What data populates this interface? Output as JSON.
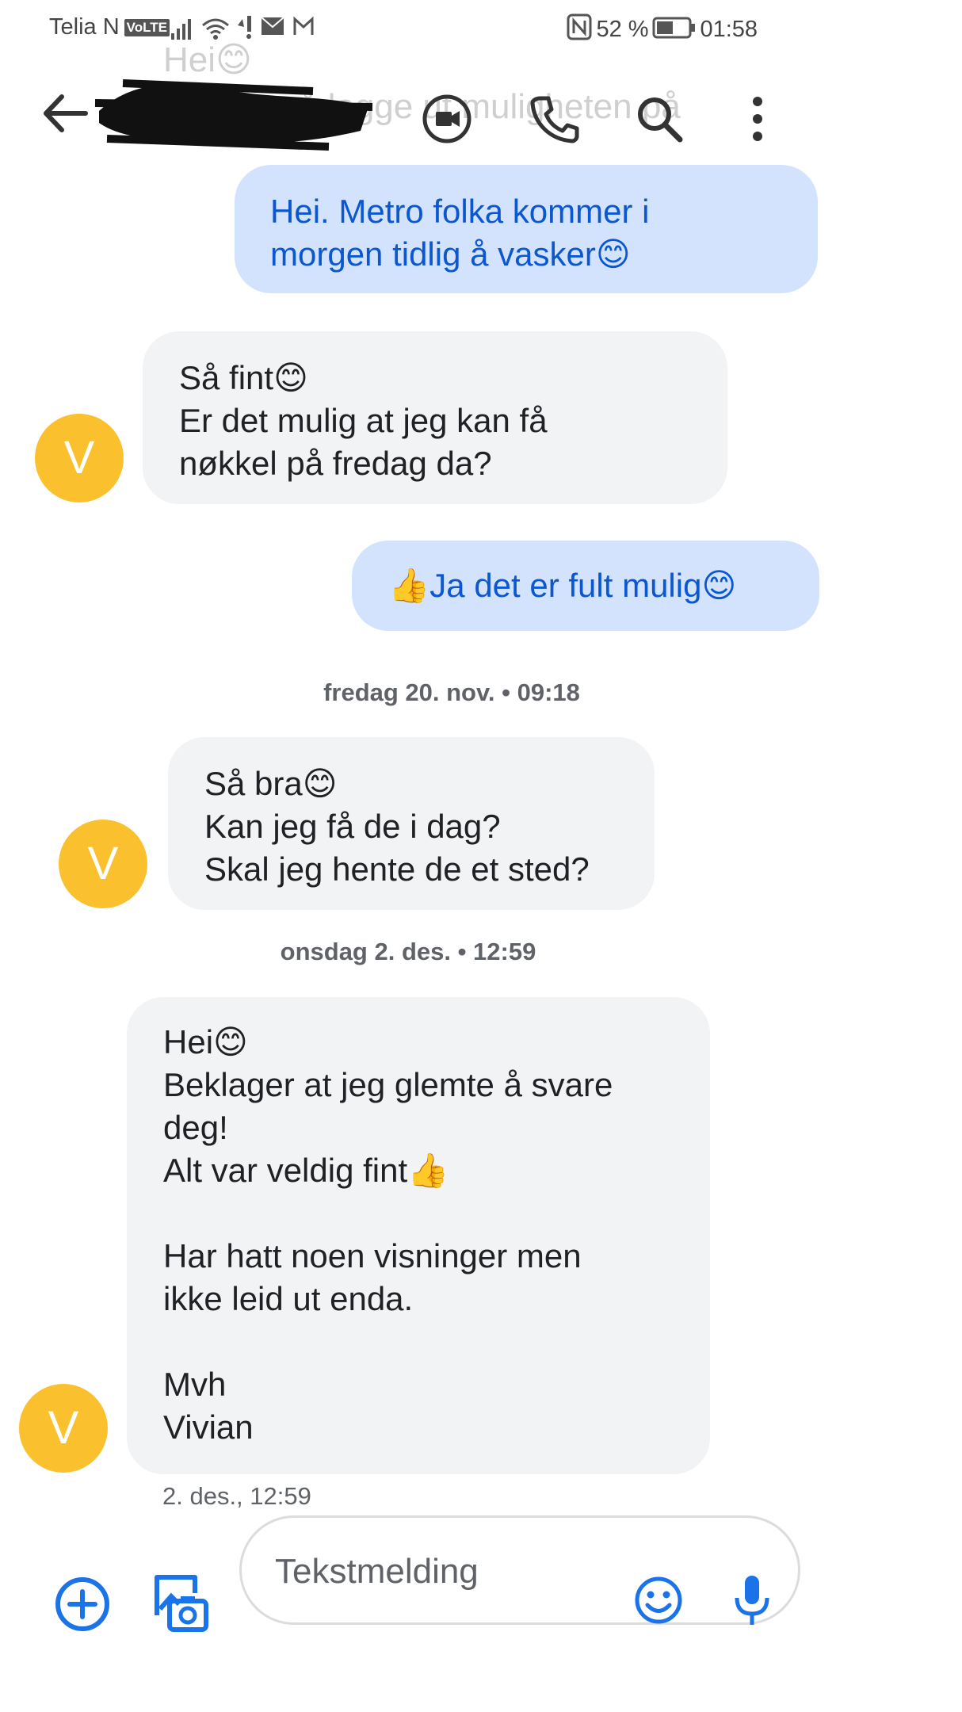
{
  "status": {
    "carrier": "Telia N",
    "network_badge": "VoLTE",
    "battery": "52 %",
    "time": "01:58"
  },
  "header": {
    "preview_line1": "Hei😊",
    "preview_line2": "r å legge ut muligheten på"
  },
  "avatar_letter": "V",
  "messages": [
    {
      "dir": "out",
      "text": "Hei. Metro folka kommer i\nmorgen tidlig å vasker😊"
    },
    {
      "dir": "in",
      "text": "Så fint😊\nEr det mulig at jeg kan få\nnøkkel på fredag da?"
    },
    {
      "dir": "out",
      "text": "👍Ja det er fult mulig😊"
    },
    {
      "dir": "in",
      "text": "Så bra😊\nKan jeg få de i dag?\nSkal jeg hente de et sted?"
    },
    {
      "dir": "in",
      "text": "Hei😊\nBeklager at jeg glemte å svare\ndeg!\nAlt var veldig fint👍\n\nHar hatt noen visninger men\nikke leid ut enda.\n\nMvh\nVivian"
    }
  ],
  "timestamps": {
    "sep1": "fredag 20. nov. • 09:18",
    "sep2": "onsdag 2. des. • 12:59",
    "last_msg": "2. des., 12:59"
  },
  "composer": {
    "placeholder": "Tekstmelding"
  },
  "colors": {
    "accent": "#1a73e8",
    "outgoing_bubble": "#d3e3fd",
    "incoming_bubble": "#f1f3f4",
    "avatar": "#fbc02d"
  },
  "icons": {
    "back": "back-arrow-icon",
    "video": "video-call-icon",
    "phone": "phone-icon",
    "search": "search-icon",
    "more": "more-vert-icon",
    "add": "add-circle-icon",
    "gallery": "gallery-camera-icon",
    "emoji": "emoji-icon",
    "mic": "mic-icon"
  }
}
